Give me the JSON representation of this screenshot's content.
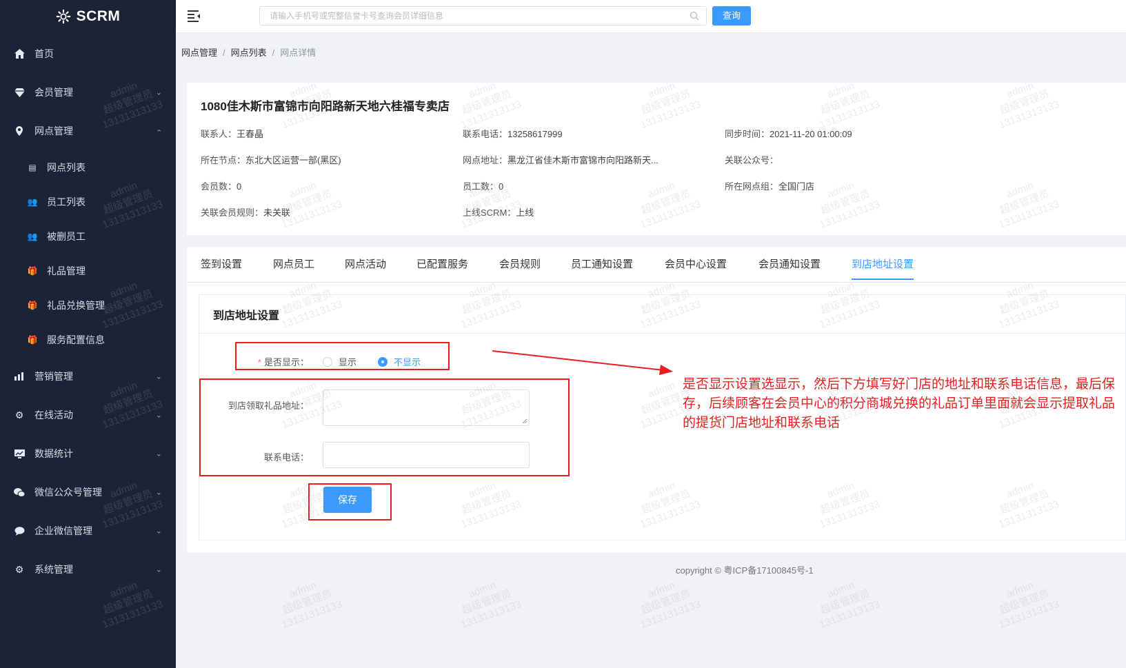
{
  "brand": {
    "name": "SCRM"
  },
  "sidebar": {
    "items": [
      {
        "label": "首页",
        "icon": "home-icon"
      },
      {
        "label": "会员管理",
        "icon": "diamond-icon"
      },
      {
        "label": "网点管理",
        "icon": "location-pin-icon"
      }
    ],
    "subitems": [
      {
        "label": "网点列表",
        "icon": "list-icon"
      },
      {
        "label": "员工列表",
        "icon": "users-icon"
      },
      {
        "label": "被删员工",
        "icon": "users-icon"
      },
      {
        "label": "礼品管理",
        "icon": "gift-icon"
      },
      {
        "label": "礼品兑换管理",
        "icon": "gift-icon"
      },
      {
        "label": "服务配置信息",
        "icon": "gift-icon"
      }
    ],
    "items2": [
      {
        "label": "营销管理",
        "icon": "bar-chart-icon"
      },
      {
        "label": "在线活动",
        "icon": "gear-icon"
      },
      {
        "label": "数据统计",
        "icon": "monitor-chart-icon"
      },
      {
        "label": "微信公众号管理",
        "icon": "wechat-icon"
      },
      {
        "label": "企业微信管理",
        "icon": "chat-bubble-icon"
      },
      {
        "label": "系统管理",
        "icon": "gear-icon"
      }
    ]
  },
  "topbar": {
    "search_placeholder": "请输入手机号或完整信誉卡号查询会员详细信息",
    "query_label": "查询"
  },
  "breadcrumb": [
    "网点管理",
    "网点列表",
    "网点详情"
  ],
  "store": {
    "title": "1080佳木斯市富锦市向阳路新天地六桂福专卖店",
    "contact_k": "联系人：",
    "contact_v": "王春晶",
    "phone_k": "联系电话：",
    "phone_v": "13258617999",
    "sync_k": "同步时间：",
    "sync_v": "2021-11-20 01:00:09",
    "node_k": "所在节点：",
    "node_v": "东北大区运营一部(黑区)",
    "addr_k": "网点地址：",
    "addr_v": "黑龙江省佳木斯市富锦市向阳路新天...",
    "mp_k": "关联公众号：",
    "mp_v": "",
    "members_k": "会员数：",
    "members_v": "0",
    "staff_k": "员工数：",
    "staff_v": "0",
    "group_k": "所在网点组：",
    "group_v": "全国门店",
    "rule_k": "关联会员规则：",
    "rule_v": "未关联",
    "online_k": "上线SCRM：",
    "online_v": "上线"
  },
  "tabs": [
    "签到设置",
    "网点员工",
    "网点活动",
    "已配置服务",
    "会员规则",
    "员工通知设置",
    "会员中心设置",
    "会员通知设置",
    "到店地址设置"
  ],
  "form": {
    "title": "到店地址设置",
    "show_label": "是否显示：",
    "opt_show": "显示",
    "opt_hide": "不显示",
    "selected": "不显示",
    "address_label": "到店领取礼品地址：",
    "address_value": "",
    "phone_label": "联系电话：",
    "phone_value": "",
    "save_label": "保存"
  },
  "annotation": "是否显示设置选显示，然后下方填写好门店的地址和联系电话信息，最后保存，后续顾客在会员中心的积分商城兑换的礼品订单里面就会显示提取礼品的提货门店地址和联系电话",
  "footer": {
    "copyright": "copyright © 粤ICP备17100845号-1"
  },
  "watermark": {
    "line1": "admin",
    "line2": "超级管理员",
    "line3": "13131313133"
  },
  "colors": {
    "sidebar_bg": "#1b2437",
    "accent": "#3a9aff",
    "annotation_red": "#e61e1e"
  }
}
